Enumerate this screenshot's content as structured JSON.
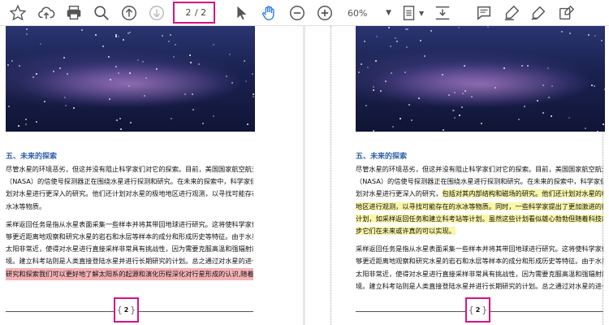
{
  "toolbar": {
    "current_page": "2",
    "total_pages": "/ 2",
    "zoom": "60%"
  },
  "colors": {
    "highlight_box": "#d6157f",
    "heading_blue": "#2e5fa8",
    "red_highlight": "#f5b2b6",
    "yellow_highlight": "#f9f6a8"
  },
  "left_page": {
    "heading": "五、未来的探索",
    "para1": [
      "尽管水星的环境恶劣，但这并没有阻止科学家们对它的探索。目前，美国国家航空航天局",
      "（NASA）的信使号探测器正在围绕水星进行探测和研究。在未来的探索中，科学家们计",
      "划对水星进行更深入的研究。他们还计划对水星的极地地区进行观测，以寻找可能存在的",
      "水冰等物质。"
    ],
    "para2": [
      "采样返回任务是指从水星表面采集一些样本并将其带回地球进行研究。这将使科学家们能",
      "够更近距离地观察和研究水星的岩石和水层等样本的成分和形成历史等特征。由于水星离",
      "太阳非常近，使得对水星进行直接采样非常具有挑战性，因为需要克服高温和强辐射的环",
      "境。建立科考站则是人类直接登陆水星并进行长期研究的计划。总之通过对水星的进一步"
    ],
    "highlight_line": "研究和探索我们可以更好地了解太阳系的起源和演化历程深化对行星形成的认识,随着科技",
    "page_number": "2"
  },
  "right_page": {
    "heading": "五、未来的探索",
    "para1_line1": "尽管水星的环境恶劣，但这并没有阻止科学家们对它的探索。目前，美国国家航空航天局",
    "para1_line2": "（NASA）的信使号探测器正在围绕水星进行探测和研究。在未来的探索中，科学家们计",
    "para1_line3_plain": "划对水星进行更深入的研究，",
    "para1_line3_hl": "包括对其内部结构和磁场的研究。他们还计划对水星的极地",
    "para1_line4": "地区进行观测，以寻找可能存在的水冰等物质。",
    "para1_line4_hl": "同时，一些科学家提出了更加激进的探索",
    "para1_line5_hl": "计划，如采样返回任务和建立科考站等计划。虽然这些计划看似雄心勃勃但随着科技的进",
    "para1_line6_hl": "步它们在未来或许真的可以实现。",
    "para2": [
      "采样返回任务是指从水星表面采集一些样本并将其带回地球进行研究。这将使科学家们能",
      "够更近距离地观察和研究水星的岩石和水层等样本的成分和形成历史等特征。由于水星离",
      "太阳非常近，使得对水星进行直接采样非常具有挑战性，因为需要克服高温和强辐射的环",
      "境。建立科考站则是人类直接登陆水星并进行长期研究的计划。总之通过对水星的进一步"
    ],
    "page_number": "2"
  }
}
